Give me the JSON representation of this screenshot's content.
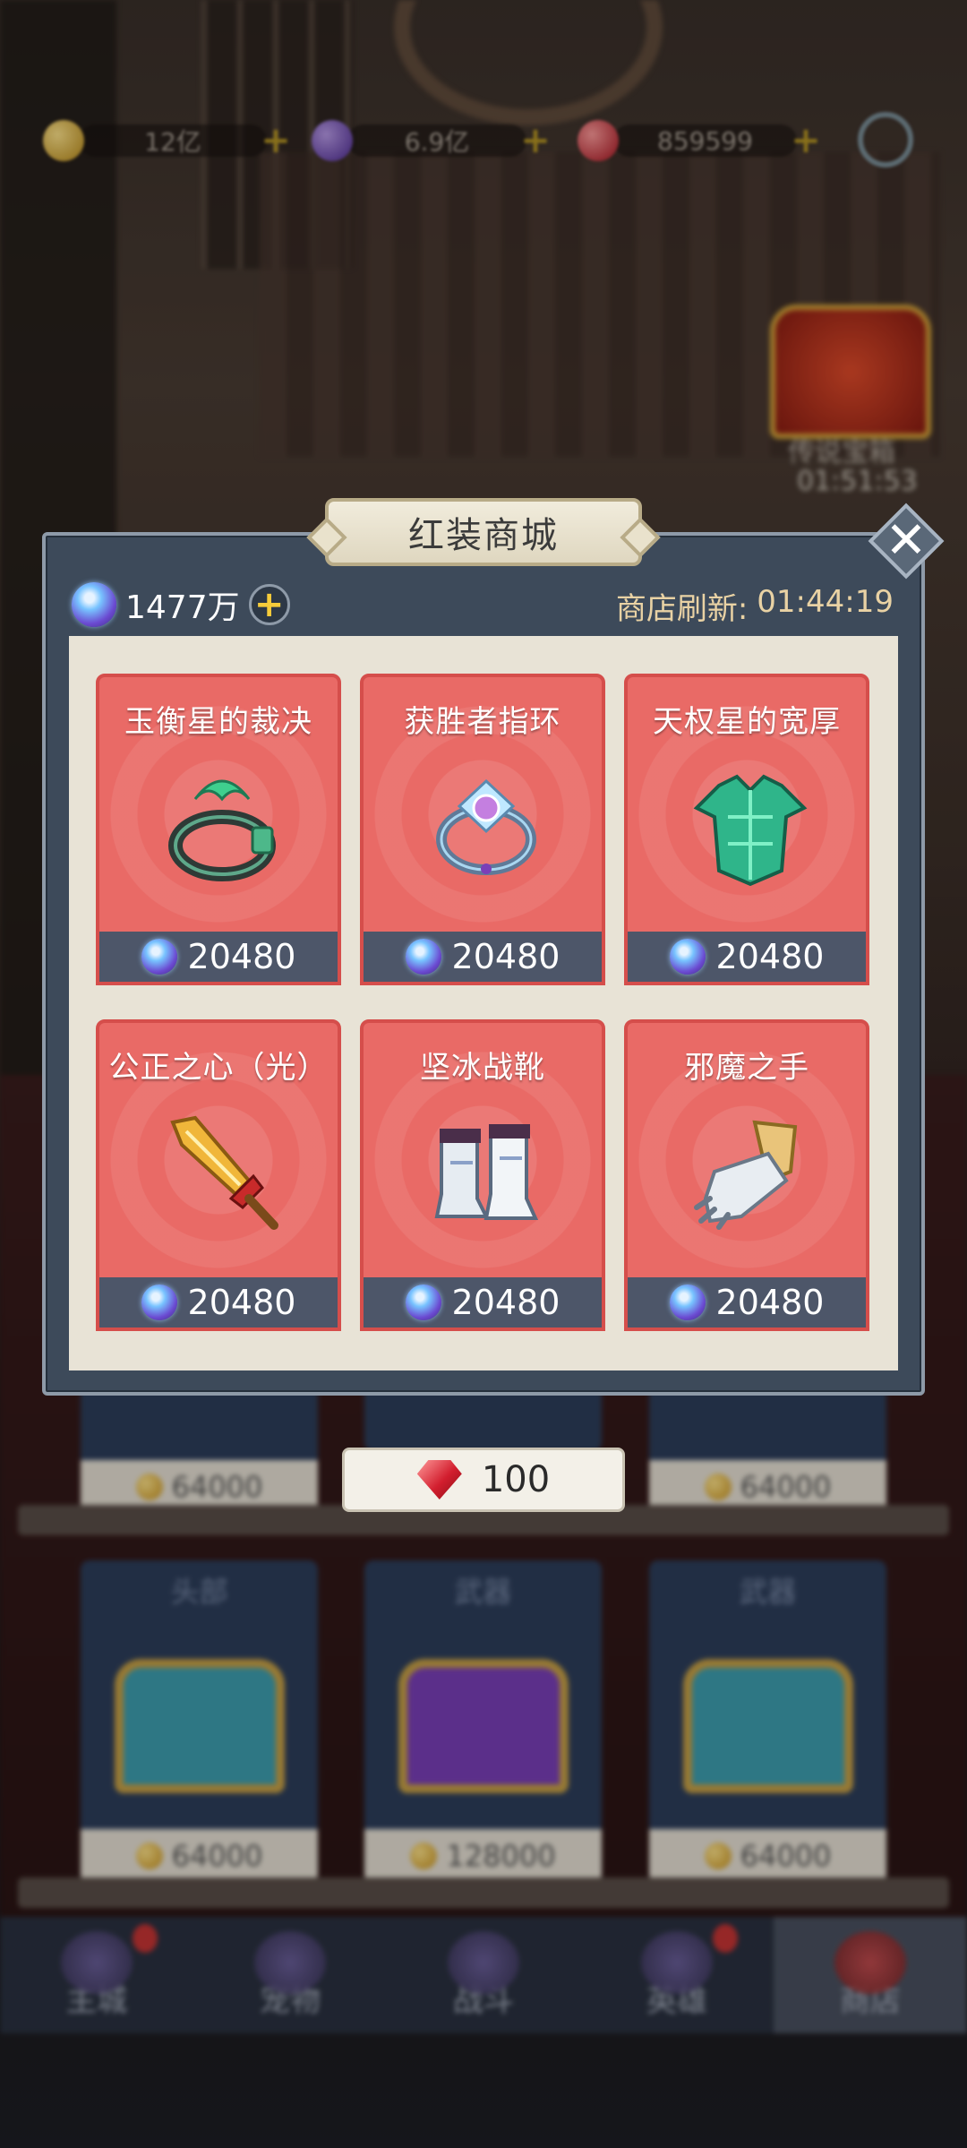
{
  "resources": [
    {
      "name": "gold",
      "value": "12亿",
      "color": "#d6a62a"
    },
    {
      "name": "purple-crystal",
      "value": "6.9亿",
      "color": "#6b3fb8"
    },
    {
      "name": "ruby",
      "value": "859599",
      "color": "#c8283a"
    }
  ],
  "background": {
    "event_chest_label": "传说宝箱",
    "event_chest_timer": "01:51:53",
    "shelf_top_prices": [
      "64000",
      "64000"
    ],
    "shelf_cards": [
      {
        "label": "头部",
        "price": "64000",
        "chest_color": "#3e9fb0"
      },
      {
        "label": "武器",
        "price": "128000",
        "chest_color": "#7a3fb8"
      },
      {
        "label": "武器",
        "price": "64000",
        "chest_color": "#3e9fb0"
      }
    ],
    "tabs": [
      {
        "label": "主城",
        "badge": true
      },
      {
        "label": "宠物",
        "badge": false
      },
      {
        "label": "战斗",
        "badge": false
      },
      {
        "label": "英雄",
        "badge": true
      },
      {
        "label": "商店",
        "badge": false,
        "active": true
      }
    ]
  },
  "modal": {
    "title": "红装商城",
    "balance": "1477万",
    "refresh_label": "商店刷新:",
    "refresh_timer": "01:44:19",
    "items": [
      {
        "name": "玉衡星的裁决",
        "price": "20480",
        "icon": "ring-icon"
      },
      {
        "name": "获胜者指环",
        "price": "20480",
        "icon": "gem-ring-icon"
      },
      {
        "name": "天权星的宽厚",
        "price": "20480",
        "icon": "armor-icon"
      },
      {
        "name": "公正之心（光）",
        "price": "20480",
        "icon": "sword-icon"
      },
      {
        "name": "坚冰战靴",
        "price": "20480",
        "icon": "boots-icon"
      },
      {
        "name": "邪魔之手",
        "price": "20480",
        "icon": "gauntlet-icon"
      }
    ],
    "refresh_cost": "100"
  }
}
